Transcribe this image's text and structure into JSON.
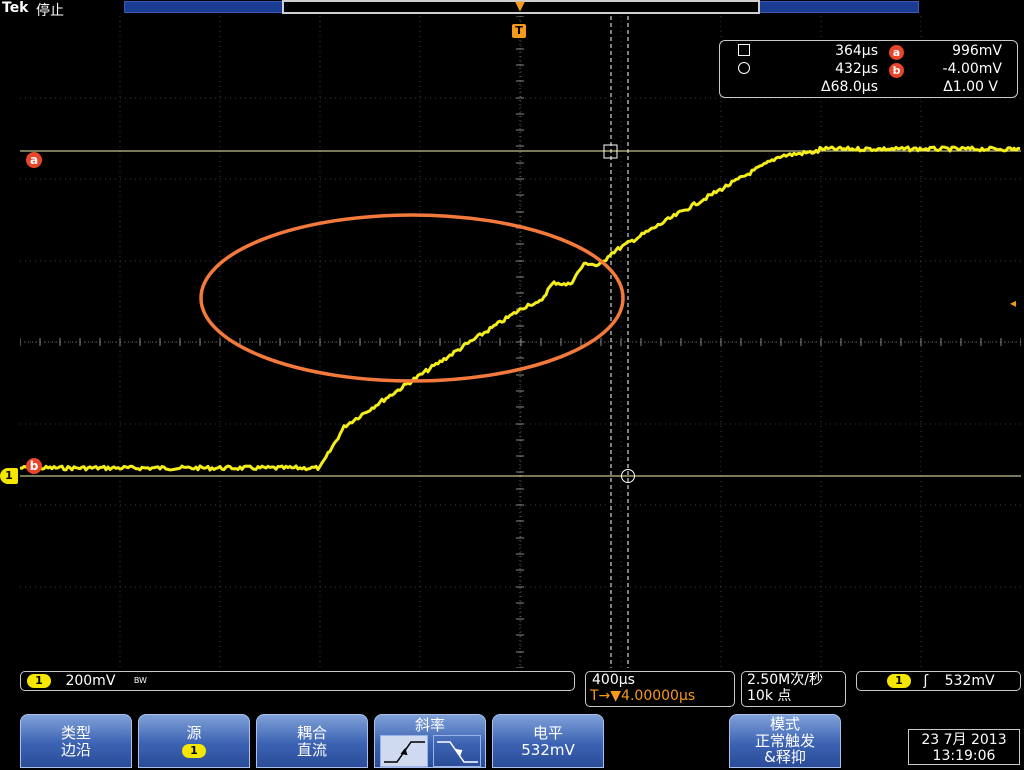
{
  "topbar": {
    "brand": "Tek",
    "run_state": "停止",
    "trigger_marker": "T"
  },
  "markers": {
    "cursor_a": "a",
    "cursor_b": "b",
    "channel": "1"
  },
  "measurement": {
    "time_1": "364µs",
    "time_2": "432µs",
    "time_delta": "Δ68.0µs",
    "a_label": "a",
    "a_value": "996mV",
    "b_label": "b",
    "b_value": "-4.00mV",
    "volt_delta": "Δ1.00 V"
  },
  "status": {
    "channel": "1",
    "ch_scale": "200mV",
    "bw_mark": "BW",
    "timebase": "400µs",
    "trigger_delay": "T→▼4.00000µs",
    "sample_rate": "2.50M次/秒",
    "record_length": "10k 点",
    "trig_channel": "1",
    "trig_slope": "ʃ",
    "trig_level": "532mV"
  },
  "menu": {
    "type_label": "类型",
    "type_value": "边沿",
    "source_label": "源",
    "source_value": "1",
    "coupling_label": "耦合",
    "coupling_value": "直流",
    "slope_label": "斜率",
    "level_label": "电平",
    "level_value": "532mV",
    "mode_label": "模式",
    "mode_value_1": "正常触发",
    "mode_value_2": "&释抑"
  },
  "clock": {
    "date": "23 7月  2013",
    "time": "13:19:06"
  },
  "colors": {
    "waveform": "#f4ee1a",
    "cursor": "#f2f0b0",
    "annotation": "#f47a3c",
    "trigger": "#f59a1c",
    "menu": "#3c63b3"
  }
}
